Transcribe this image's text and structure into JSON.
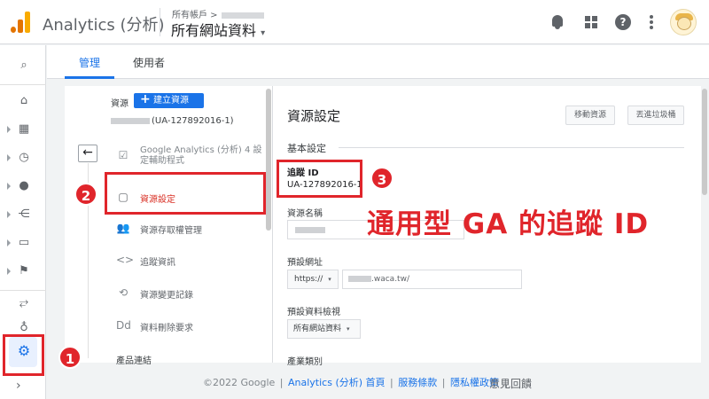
{
  "header": {
    "app_title": "Analytics (分析)",
    "account_label": "所有帳戶 >",
    "property_title": "所有網站資料",
    "caret": "▾",
    "help_glyph": "?"
  },
  "tabs": [
    {
      "label": "管理"
    },
    {
      "label": "使用者"
    }
  ],
  "admin": {
    "column_label": "資源",
    "create_button": "建立資源",
    "create_plus": "+",
    "property_id": "(UA-127892016-1)",
    "back_glyph": "←",
    "menu": [
      {
        "label": "Google Analytics (分析) 4 設定輔助程式",
        "icon": "check-square-icon",
        "glyph": "☑"
      },
      {
        "label": "資源設定",
        "icon": "window-icon",
        "glyph": "▢"
      },
      {
        "label": "資源存取權管理",
        "icon": "people-icon",
        "glyph": "👥"
      },
      {
        "label": "追蹤資訊",
        "icon": "code-icon",
        "glyph": "<>"
      },
      {
        "label": "資源變更記錄",
        "icon": "history-icon",
        "glyph": "⟲"
      },
      {
        "label": "資料刪除要求",
        "icon": "dd-icon",
        "glyph": "Dd"
      }
    ],
    "section_label": "產品連結"
  },
  "panel": {
    "title": "資源設定",
    "move_button": "移動資源",
    "trash_button": "丟進垃圾桶",
    "basic_section": "基本設定",
    "tracking_id_label": "追蹤 ID",
    "tracking_id_value": "UA-127892016-1",
    "property_name_label": "資源名稱",
    "default_url_label": "預設網址",
    "protocol_value": "https://",
    "url_value": ".waca.tw/",
    "default_view_label": "預設資料檢視",
    "default_view_value": "所有網站資料",
    "category_label": "產業類別"
  },
  "annotations": {
    "badge1": "1",
    "badge2": "2",
    "badge3": "3",
    "callout": "通用型 GA 的追蹤 ID",
    "highlight_color": "#e0252b"
  },
  "footer": {
    "copyright": "©2022 Google",
    "link_home": "Analytics (分析) 首頁",
    "link_terms": "服務條款",
    "link_privacy": "隱私權政策",
    "separator": "|",
    "feedback": "意見回饋"
  },
  "colors": {
    "accent": "#1a73e8",
    "header_logo": "#f9ab00"
  }
}
